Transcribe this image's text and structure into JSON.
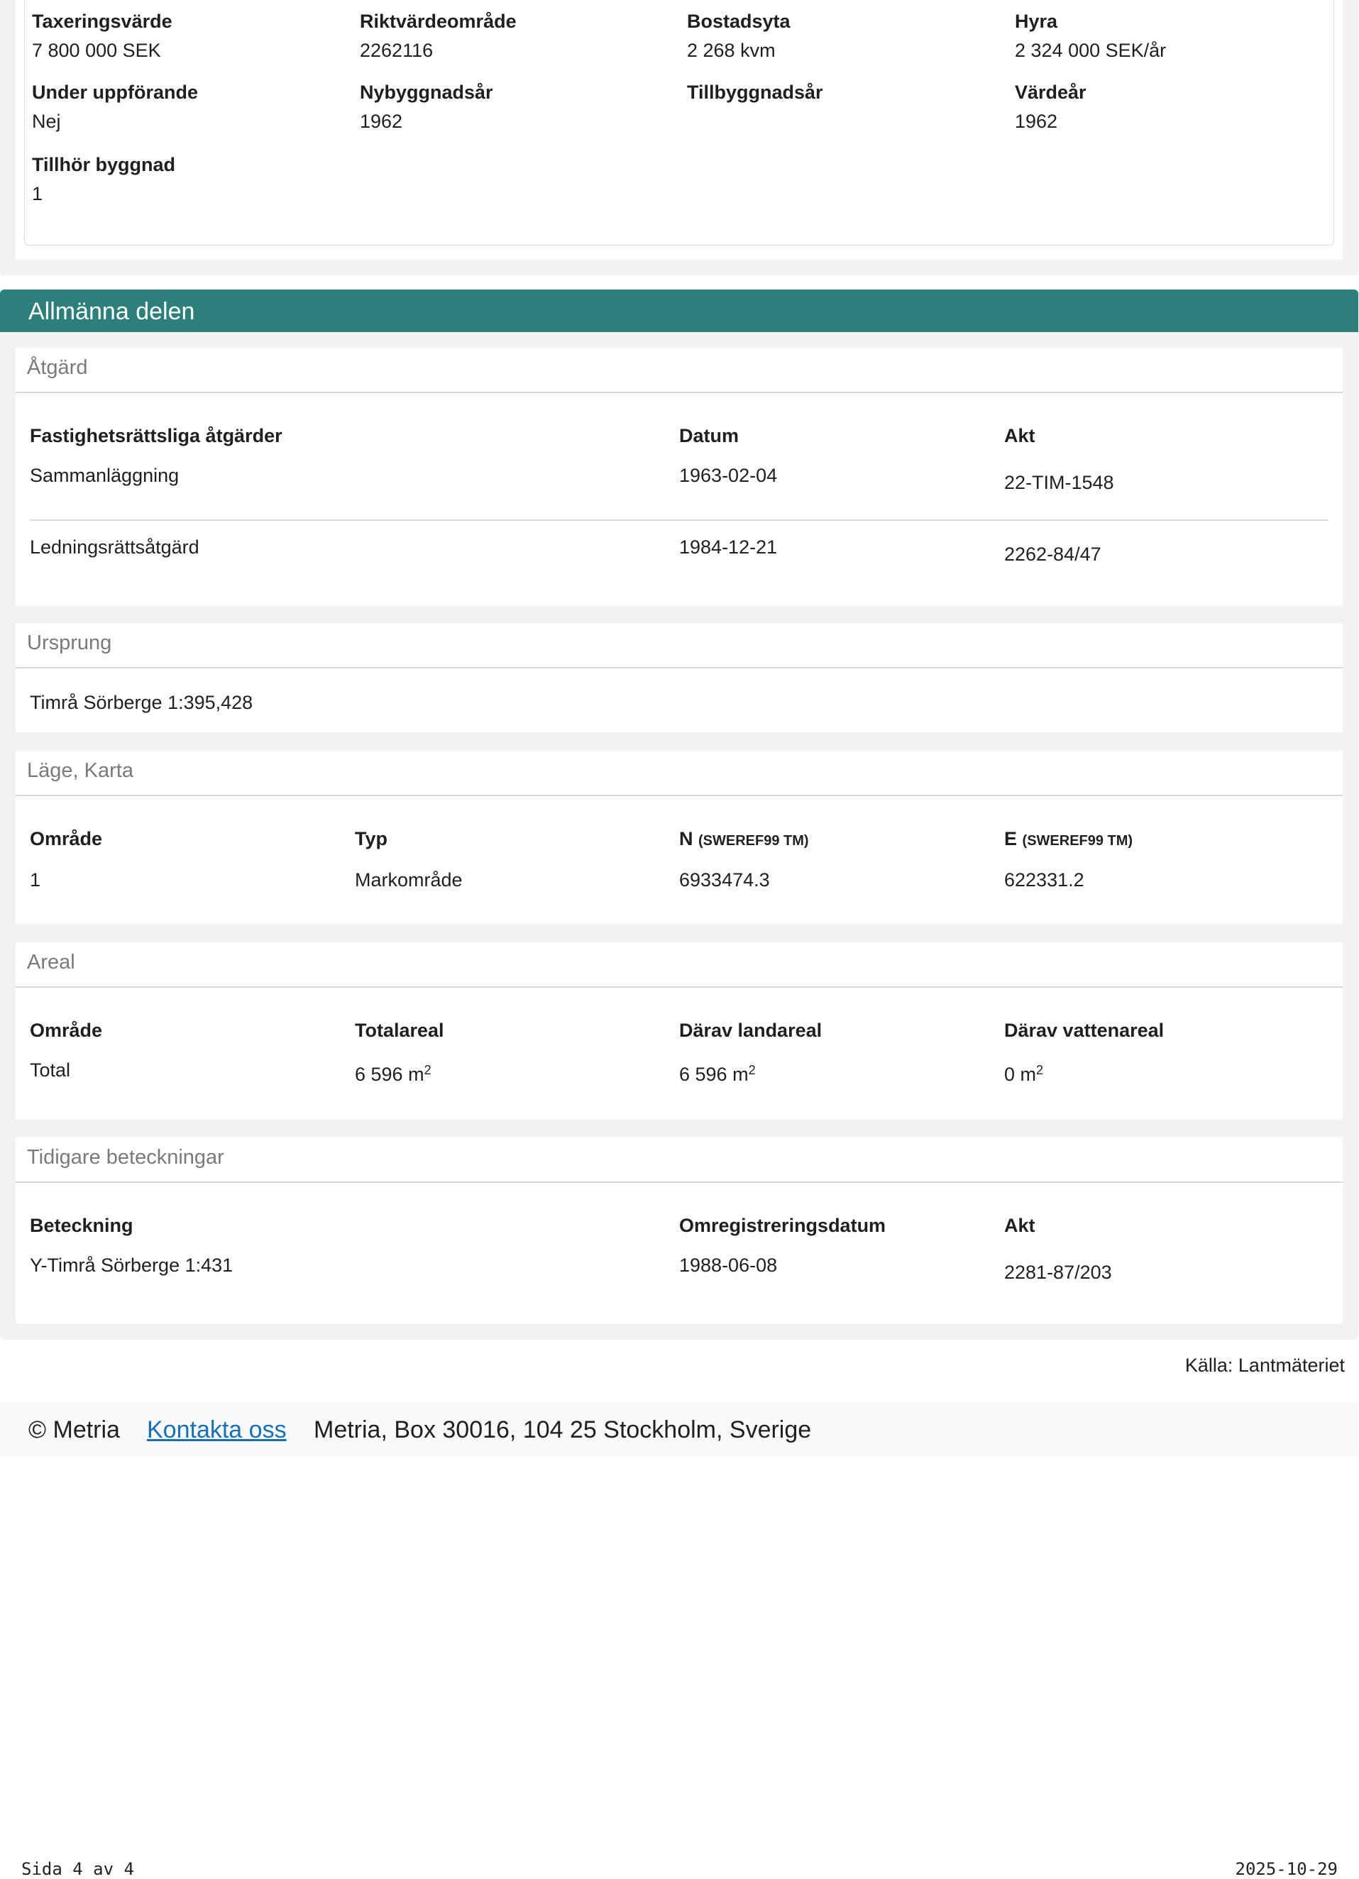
{
  "building": {
    "fields": [
      {
        "label": "Taxeringsvärde",
        "value": "7 800 000 SEK"
      },
      {
        "label": "Riktvärdeområde",
        "value": "2262116"
      },
      {
        "label": "Bostadsyta",
        "value": "2 268 kvm"
      },
      {
        "label": "Hyra",
        "value": "2 324 000 SEK/år"
      },
      {
        "label": "Under uppförande",
        "value": "Nej"
      },
      {
        "label": "Nybyggnadsår",
        "value": "1962"
      },
      {
        "label": "Tillbyggnadsår",
        "value": ""
      },
      {
        "label": "Värdeår",
        "value": "1962"
      },
      {
        "label": "Tillhör byggnad",
        "value": "1"
      }
    ]
  },
  "section_title": "Allmänna delen",
  "atgard": {
    "title": "Åtgärd",
    "headers": [
      "Fastighetsrättsliga åtgärder",
      "Datum",
      "Akt"
    ],
    "rows": [
      [
        "Sammanläggning",
        "1963-02-04",
        "22-TIM-1548"
      ],
      [
        "Ledningsrättsåtgärd",
        "1984-12-21",
        "2262-84/47"
      ]
    ]
  },
  "ursprung": {
    "title": "Ursprung",
    "value": "Timrå Sörberge 1:395,428"
  },
  "lage": {
    "title": "Läge, Karta",
    "headers": [
      "Område",
      "Typ",
      "N",
      "E"
    ],
    "coord_unit": "(SWEREF99 TM)",
    "row": [
      "1",
      "Markområde",
      "6933474.3",
      "622331.2"
    ]
  },
  "areal": {
    "title": "Areal",
    "headers": [
      "Område",
      "Totalareal",
      "Därav landareal",
      "Därav vattenareal"
    ],
    "row": [
      "Total",
      "6 596 m",
      "6 596 m",
      "0 m"
    ],
    "unit_exponent": "2"
  },
  "tidigare": {
    "title": "Tidigare beteckningar",
    "headers": [
      "Beteckning",
      "Omregistreringsdatum",
      "Akt"
    ],
    "row": [
      "Y-Timrå Sörberge 1:431",
      "1988-06-08",
      "2281-87/203"
    ]
  },
  "source": "Källa: Lantmäteriet",
  "footer": {
    "copyright": "© Metria",
    "contact_link": "Kontakta oss",
    "address": "Metria, Box 30016, 104 25 Stockholm, Sverige"
  },
  "page": {
    "number": "Sida 4 av 4",
    "date": "2025-10-29"
  }
}
